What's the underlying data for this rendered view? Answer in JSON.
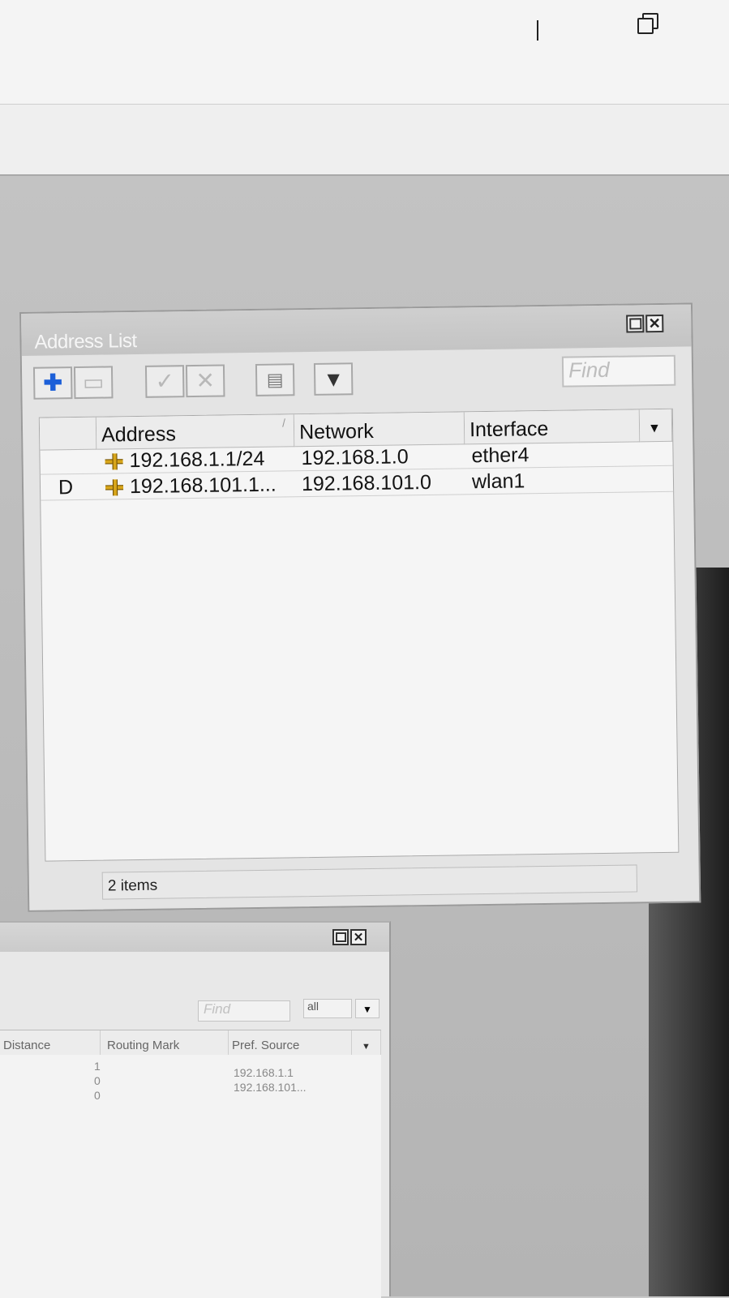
{
  "address_window": {
    "title": "Address List",
    "find_placeholder": "Find",
    "toolbar": {
      "add_icon": "plus-icon",
      "remove_icon": "minus-icon",
      "enable_icon": "check-icon",
      "disable_icon": "x-icon",
      "comment_icon": "note-icon",
      "filter_icon": "filter-icon"
    },
    "columns": {
      "flag": "",
      "address": "Address",
      "network": "Network",
      "interface": "Interface"
    },
    "rows": [
      {
        "flag": "",
        "address": "192.168.1.1/24",
        "network": "192.168.1.0",
        "interface": "ether4"
      },
      {
        "flag": "D",
        "address": "192.168.101.1...",
        "network": "192.168.101.0",
        "interface": "wlan1"
      }
    ],
    "status": "2 items"
  },
  "route_window": {
    "find_placeholder": "Find",
    "filter_value": "all",
    "columns": {
      "distance": "Distance",
      "routing_mark": "Routing Mark",
      "pref_source": "Pref. Source"
    },
    "rows": [
      {
        "distance": "1",
        "pref_source": "192.168.1.1"
      },
      {
        "distance": "0",
        "pref_source": "192.168.101..."
      },
      {
        "distance": "0",
        "pref_source": ""
      }
    ]
  }
}
